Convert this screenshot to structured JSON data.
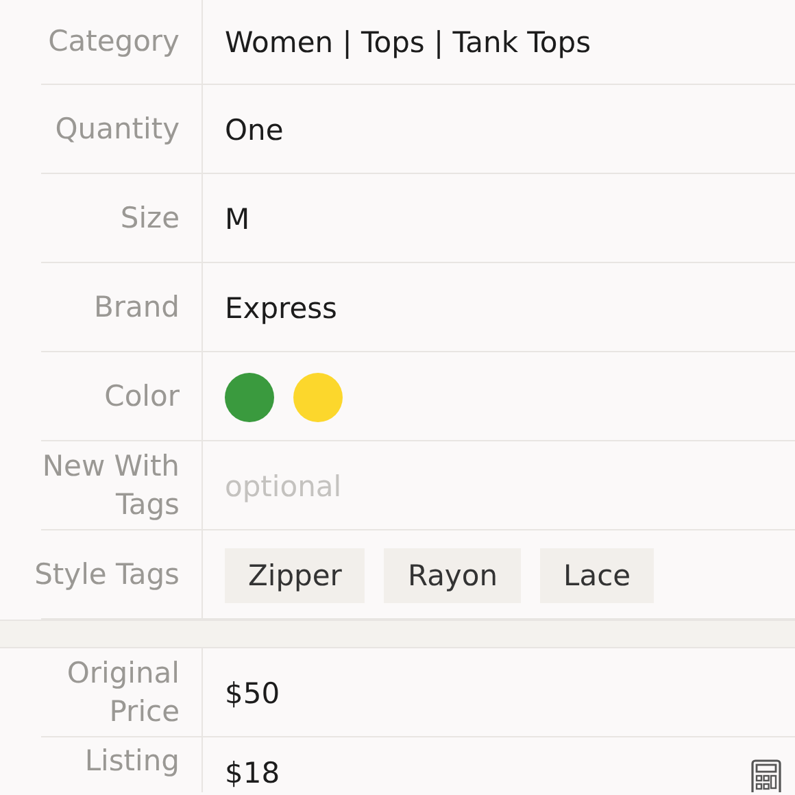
{
  "fields": [
    {
      "label": "Category",
      "kind": "text",
      "value": "Women | Tops | Tank Tops"
    },
    {
      "label": "Quantity",
      "kind": "text",
      "value": "One"
    },
    {
      "label": "Size",
      "kind": "text",
      "value": "M"
    },
    {
      "label": "Brand",
      "kind": "text",
      "value": "Express"
    },
    {
      "label": "Color",
      "kind": "colors",
      "colors": [
        {
          "color": "#3a9a3e"
        },
        {
          "color": "#fcd72c"
        }
      ]
    },
    {
      "label": "New With Tags",
      "kind": "input",
      "placeholder": "optional"
    },
    {
      "label": "Style Tags",
      "kind": "tags",
      "tags": [
        "Zipper",
        "Rayon",
        "Lace"
      ]
    }
  ],
  "pricing": [
    {
      "label": "Original Price",
      "value": "$50",
      "calculator": false
    },
    {
      "label": "Listing",
      "value": "$18",
      "calculator": true
    }
  ]
}
